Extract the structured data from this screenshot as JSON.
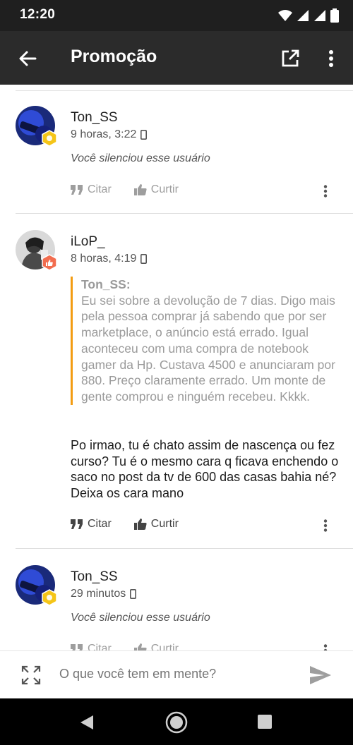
{
  "status_bar": {
    "time": "12:20"
  },
  "app_bar": {
    "title": "Promoção",
    "back_icon": "arrow-left-icon",
    "open_icon": "open-external-icon",
    "menu_icon": "more-vertical-icon"
  },
  "posts": [
    {
      "username": "Ton_SS",
      "time": "9 horas, 3:22",
      "silenced_text": "Você silenciou esse usuário",
      "quote_label": "Citar",
      "like_label": "Curtir",
      "badge_color": "#f5c518"
    },
    {
      "username": "iLoP_",
      "time": "8 horas, 4:19",
      "quote": {
        "author": "Ton_SS:",
        "text": "Eu sei sobre a devolução de 7 dias. Digo mais pela pessoa comprar já sabendo que por ser marketplace, o anúncio está errado. Igual aconteceu com uma compra de notebook gamer da Hp. Custava 4500 e anunciaram por 880. Preço claramente errado. Um monte de gente comprou e ninguém recebeu. Kkkk."
      },
      "body": "Po irmao, tu é chato assim de nascença ou fez curso? Tu é o mesmo cara q ficava enchendo o saco no post da tv de 600 das casas bahia né? Deixa os cara mano",
      "quote_label": "Citar",
      "like_label": "Curtir",
      "badge_color": "#f26d4f"
    },
    {
      "username": "Ton_SS",
      "time": "29 minutos",
      "silenced_text": "Você silenciou esse usuário",
      "quote_label": "Citar",
      "like_label": "Curtir",
      "badge_color": "#f5c518"
    }
  ],
  "composer": {
    "placeholder": "O que você tem em mente?"
  },
  "colors": {
    "app_bar": "#2b2b2b",
    "status_bar": "#1f1f1f",
    "quote_border": "#f39c12"
  }
}
